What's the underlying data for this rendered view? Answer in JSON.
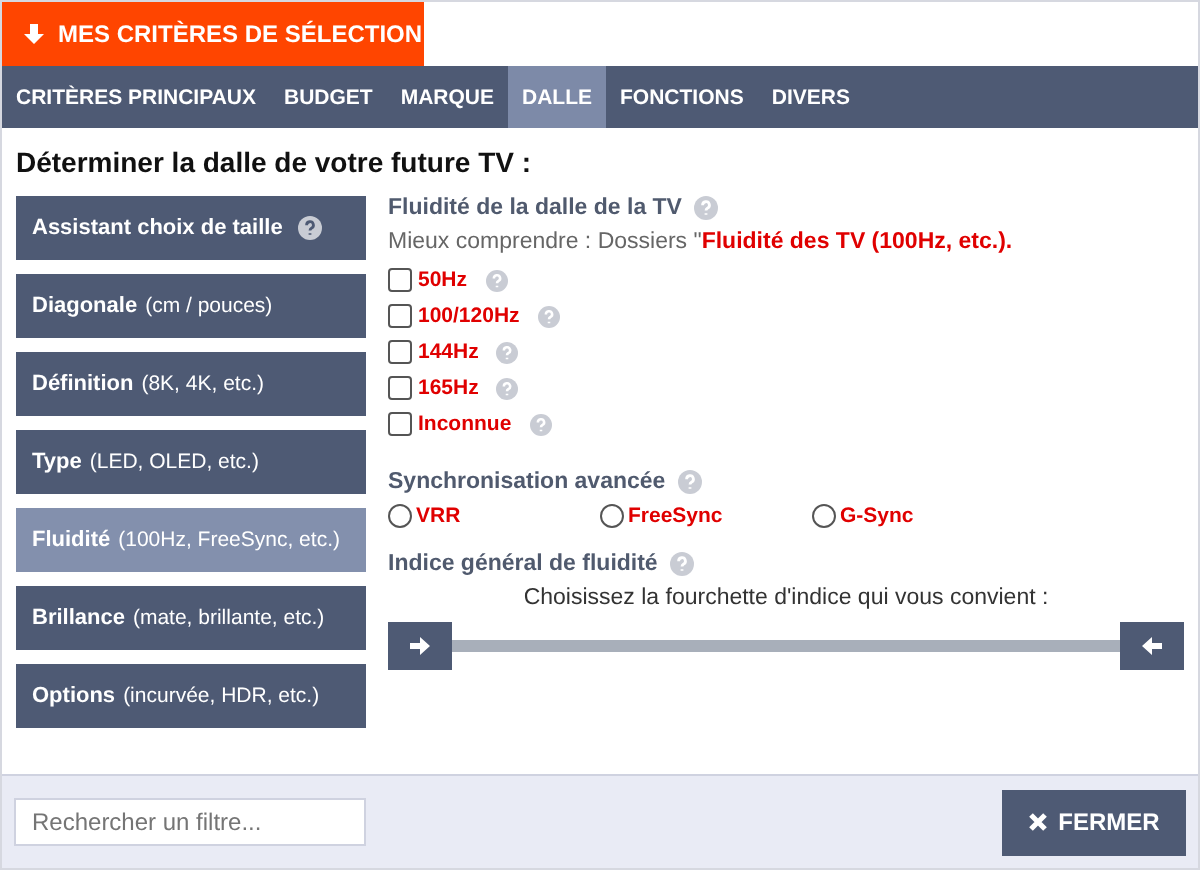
{
  "header_button": {
    "label": "MES CRITÈRES DE SÉLECTION"
  },
  "tabs": [
    {
      "label": "CRITÈRES PRINCIPAUX",
      "selected": false
    },
    {
      "label": "BUDGET",
      "selected": false
    },
    {
      "label": "MARQUE",
      "selected": false
    },
    {
      "label": "DALLE",
      "selected": true
    },
    {
      "label": "FONCTIONS",
      "selected": false
    },
    {
      "label": "DIVERS",
      "selected": false
    }
  ],
  "heading": "Déterminer la dalle de votre future TV :",
  "sidebar": [
    {
      "label": "Assistant choix de taille",
      "help": true,
      "selected": false
    },
    {
      "label": "Diagonale",
      "detail": "(cm / pouces)",
      "selected": false
    },
    {
      "label": "Définition",
      "detail": "(8K, 4K, etc.)",
      "selected": false
    },
    {
      "label": "Type",
      "detail": "(LED, OLED, etc.)",
      "selected": false
    },
    {
      "label": "Fluidité",
      "detail": "(100Hz, FreeSync, etc.)",
      "selected": true
    },
    {
      "label": "Brillance",
      "detail": "(mate, brillante, etc.)",
      "selected": false
    },
    {
      "label": "Options",
      "detail": "(incurvée, HDR, etc.)",
      "selected": false
    }
  ],
  "sections": [
    {
      "kind": "checkboxes",
      "title": "Fluidité de la dalle de la TV",
      "intro": "Mieux comprendre : Dossiers \"",
      "link": "Fluidité des TV (100Hz, etc.).",
      "options": [
        {
          "label": "50Hz",
          "checked": false
        },
        {
          "label": "100/120Hz",
          "checked": false
        },
        {
          "label": "144Hz",
          "checked": false
        },
        {
          "label": "165Hz",
          "checked": false
        },
        {
          "label": "Inconnue",
          "checked": false
        }
      ]
    },
    {
      "kind": "radios",
      "title": "Synchronisation avancée",
      "options": [
        {
          "label": "VRR",
          "selected": false
        },
        {
          "label": "FreeSync",
          "selected": false
        },
        {
          "label": "G-Sync",
          "selected": false
        }
      ]
    },
    {
      "kind": "range",
      "title": "Indice général de fluidité",
      "prompt": "Choisissez la fourchette d'indice qui vous convient :",
      "handles": [
        {
          "level": 0
        },
        {
          "level": 1
        }
      ]
    }
  ],
  "search": {
    "placeholder": "Rechercher un filtre..."
  },
  "close_button": {
    "label": "FERMER"
  }
}
